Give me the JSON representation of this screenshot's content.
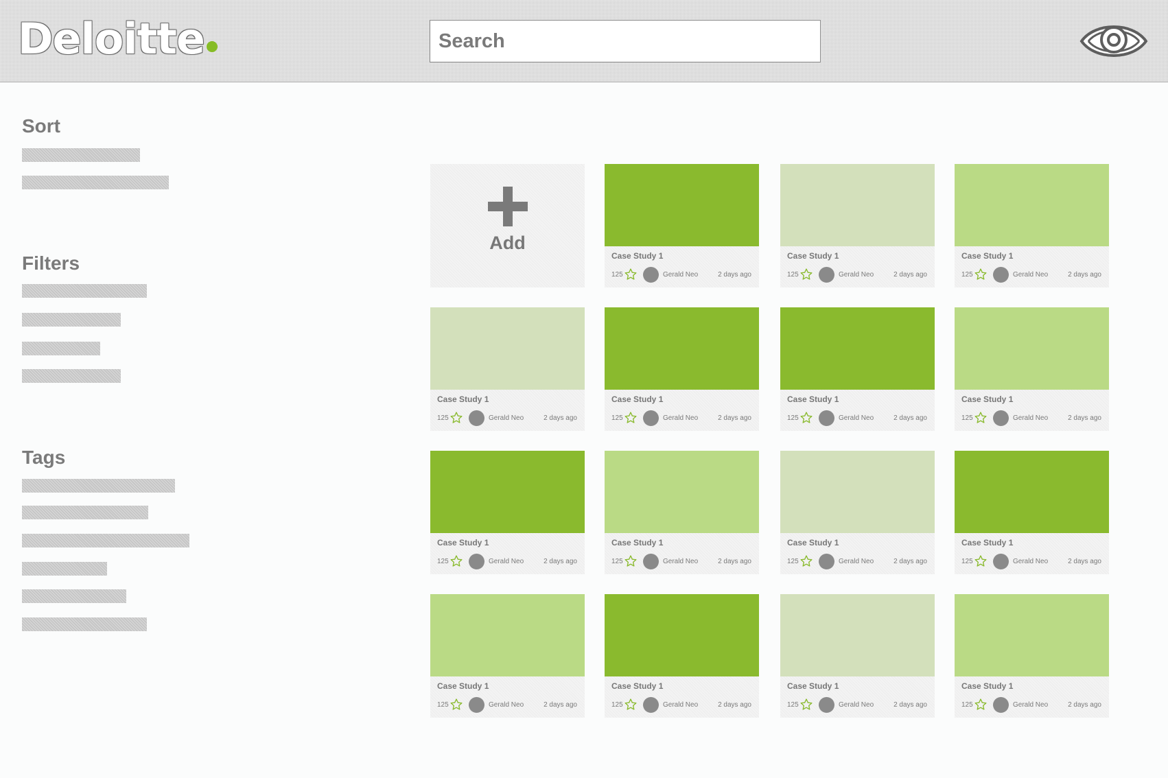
{
  "header": {
    "logo_text": "Deloitte",
    "search_placeholder": "Search",
    "brand_green": "#86bc25"
  },
  "sidebar": {
    "sort_title": "Sort",
    "filters_title": "Filters",
    "tags_title": "Tags"
  },
  "add_tile": {
    "label": "Add"
  },
  "thumbnail_colors": {
    "dark": "#8aba2e",
    "medium": "#bada85",
    "light": "#d3e0bb"
  },
  "cards": [
    {
      "title": "Case Study 1",
      "count": "125",
      "author": "Gerald Neo",
      "time": "2 days ago",
      "shade": "dark"
    },
    {
      "title": "Case Study 1",
      "count": "125",
      "author": "Gerald Neo",
      "time": "2 days ago",
      "shade": "light"
    },
    {
      "title": "Case Study 1",
      "count": "125",
      "author": "Gerald Neo",
      "time": "2 days ago",
      "shade": "medium"
    },
    {
      "title": "Case Study 1",
      "count": "125",
      "author": "Gerald Neo",
      "time": "2 days ago",
      "shade": "light"
    },
    {
      "title": "Case Study 1",
      "count": "125",
      "author": "Gerald Neo",
      "time": "2 days ago",
      "shade": "dark"
    },
    {
      "title": "Case Study 1",
      "count": "125",
      "author": "Gerald Neo",
      "time": "2 days ago",
      "shade": "dark"
    },
    {
      "title": "Case Study 1",
      "count": "125",
      "author": "Gerald Neo",
      "time": "2 days ago",
      "shade": "medium"
    },
    {
      "title": "Case Study 1",
      "count": "125",
      "author": "Gerald Neo",
      "time": "2 days ago",
      "shade": "dark"
    },
    {
      "title": "Case Study 1",
      "count": "125",
      "author": "Gerald Neo",
      "time": "2 days ago",
      "shade": "medium"
    },
    {
      "title": "Case Study 1",
      "count": "125",
      "author": "Gerald Neo",
      "time": "2 days ago",
      "shade": "light"
    },
    {
      "title": "Case Study 1",
      "count": "125",
      "author": "Gerald Neo",
      "time": "2 days ago",
      "shade": "dark"
    },
    {
      "title": "Case Study 1",
      "count": "125",
      "author": "Gerald Neo",
      "time": "2 days ago",
      "shade": "medium"
    },
    {
      "title": "Case Study 1",
      "count": "125",
      "author": "Gerald Neo",
      "time": "2 days ago",
      "shade": "dark"
    },
    {
      "title": "Case Study 1",
      "count": "125",
      "author": "Gerald Neo",
      "time": "2 days ago",
      "shade": "light"
    },
    {
      "title": "Case Study 1",
      "count": "125",
      "author": "Gerald Neo",
      "time": "2 days ago",
      "shade": "medium"
    }
  ]
}
